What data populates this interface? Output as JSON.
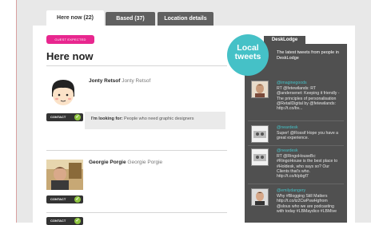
{
  "tabs": [
    {
      "label": "Here now (22)"
    },
    {
      "label": "Based (37)"
    },
    {
      "label": "Location details"
    }
  ],
  "badge": "GUEST EXPECTED",
  "page_title": "Here now",
  "people": [
    {
      "name": "Jonty Retsof",
      "handle": "Jonty Retsof",
      "contact_label": "CONTACT"
    },
    {
      "name": "Georgie Porgie",
      "handle": "Georgie Porgie",
      "contact_label": "CONTACT"
    },
    {
      "contact_label": "CONTACT"
    }
  ],
  "looking_for": {
    "label": "I'm looking for:",
    "text": "People who need graphic designers"
  },
  "sidebar": {
    "tab": "DeskLodge",
    "circle_line1": "Local",
    "circle_line2": "tweets",
    "description": "The latest tweets from people in DeskLodge",
    "tweets": [
      {
        "handle": "@imaginegoods",
        "text": "RT @fetewilands: RT @andersenet: Keeping it friendly - The principles of personalisation @RetailDigital by @fetewilands: http://t.co/bv..."
      },
      {
        "handle": "@neardesk",
        "text": "Super! @Rossif Hope you have a great experience."
      },
      {
        "handle": "@neardesk",
        "text": "RT @RingoHouseBc: #RingoHouse is the best place to #Holdesk, who says so? Our Clients that's who. http://t.co/kIpbgf7"
      },
      {
        "handle": "@emilydangery",
        "text": "Why #Blogging Still Matters http://t.co/iz2CwPswHgfrom @slous who we are podcasting with today #LBMaydico #LBMive"
      }
    ]
  }
}
